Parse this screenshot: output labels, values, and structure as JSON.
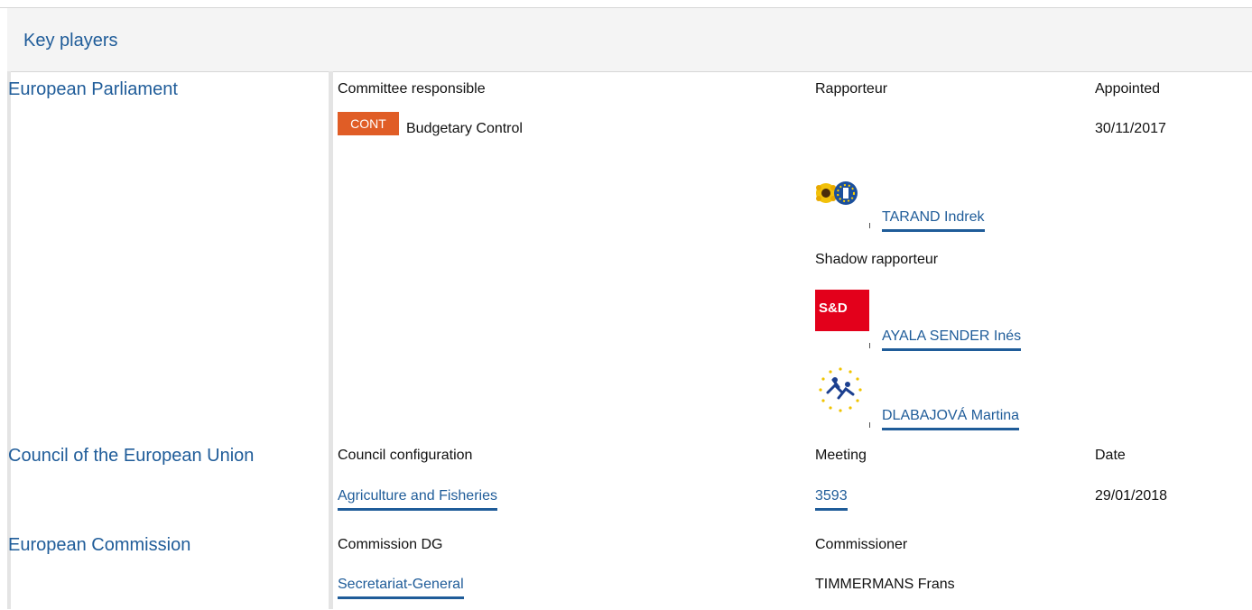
{
  "header": {
    "title": "Key players"
  },
  "ep": {
    "title": "European Parliament",
    "col_committee": "Committee responsible",
    "col_rapporteur": "Rapporteur",
    "col_appointed": "Appointed",
    "committee_code": "CONT",
    "committee_name": "Budgetary Control",
    "appointed_date": "30/11/2017",
    "rapporteur": {
      "name": "TARAND Indrek",
      "group_icon": "greens-efa-logo"
    },
    "shadow_label": "Shadow rapporteur",
    "shadows": [
      {
        "name": "AYALA SENDER Inés",
        "group_icon": "s-and-d-logo",
        "logo_text": "S&D"
      },
      {
        "name": "DLABAJOVÁ Martina",
        "group_icon": "alde-logo"
      }
    ],
    "badge_color": "#e05d26"
  },
  "council": {
    "title": "Council of the European Union",
    "col_configuration": "Council configuration",
    "col_meeting": "Meeting",
    "col_date": "Date",
    "configuration": "Agriculture and Fisheries",
    "meeting": "3593",
    "date": "29/01/2018"
  },
  "commission": {
    "title": "European Commission",
    "col_dg": "Commission DG",
    "col_commissioner": "Commissioner",
    "dg": "Secretariat-General",
    "commissioner": "TIMMERMANS Frans"
  }
}
